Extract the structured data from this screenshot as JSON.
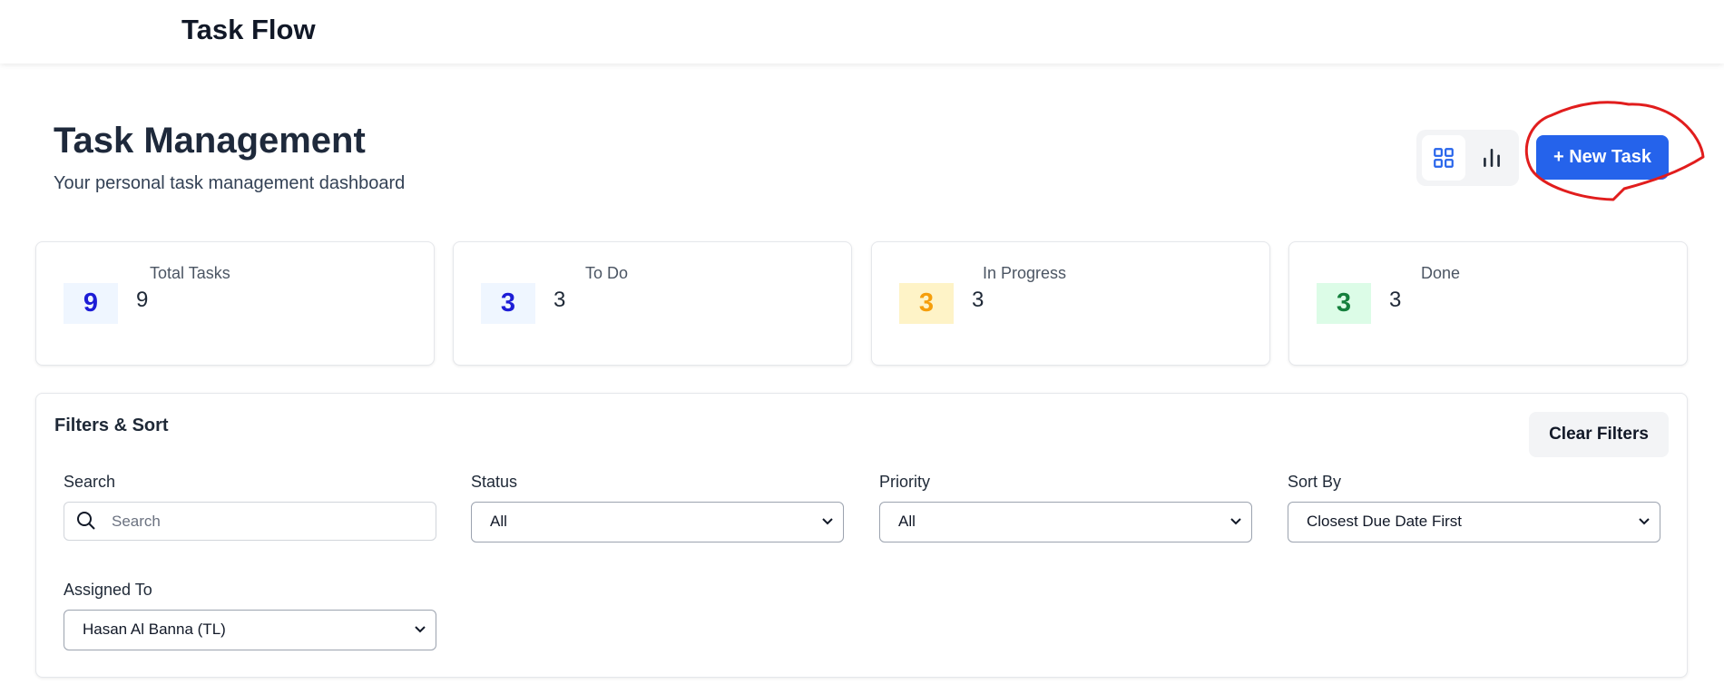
{
  "app": {
    "brand": "Task Flow"
  },
  "header": {
    "title": "Task Management",
    "subtitle": "Your personal task management dashboard",
    "view_toggle": {
      "grid_icon": "grid-icon",
      "chart_icon": "bar-chart-icon"
    },
    "new_task_label": "+ New Task",
    "annotation_color": "#e11d1d"
  },
  "stats": [
    {
      "label": "Total Tasks",
      "badge": "9",
      "value": "9",
      "badge_color": "#1d1dd6",
      "badge_bg": "#eff6ff"
    },
    {
      "label": "To Do",
      "badge": "3",
      "value": "3",
      "badge_color": "#1d1dd6",
      "badge_bg": "#eff6ff"
    },
    {
      "label": "In Progress",
      "badge": "3",
      "value": "3",
      "badge_color": "#f59e0b",
      "badge_bg": "#fef3c7"
    },
    {
      "label": "Done",
      "badge": "3",
      "value": "3",
      "badge_color": "#15803d",
      "badge_bg": "#dcfce7"
    }
  ],
  "filters": {
    "title": "Filters & Sort",
    "clear_label": "Clear Filters",
    "search": {
      "label": "Search",
      "placeholder": "Search",
      "value": ""
    },
    "status": {
      "label": "Status",
      "selected": "All"
    },
    "priority": {
      "label": "Priority",
      "selected": "All"
    },
    "sort_by": {
      "label": "Sort By",
      "selected": "Closest Due Date First"
    },
    "assigned_to": {
      "label": "Assigned To",
      "selected": "Hasan Al Banna (TL)"
    }
  },
  "colors": {
    "accent": "#2563eb"
  }
}
